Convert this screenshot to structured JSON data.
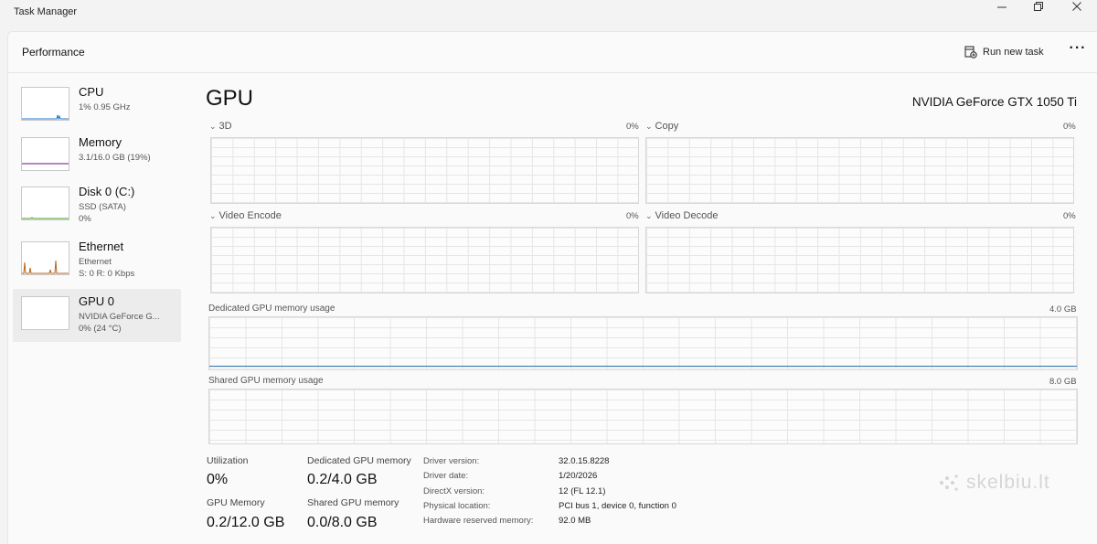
{
  "window": {
    "title": "Task Manager",
    "controls": [
      "minimize-icon",
      "restore-icon",
      "close-icon"
    ]
  },
  "header": {
    "title": "Performance",
    "run_task_label": "Run new task",
    "more_label": "···"
  },
  "sidebar": {
    "items": [
      {
        "label": "CPU",
        "sub1": "1% 0.95 GHz",
        "sub2": ""
      },
      {
        "label": "Memory",
        "sub1": "3.1/16.0 GB (19%)",
        "sub2": ""
      },
      {
        "label": "Disk 0 (C:)",
        "sub1": "SSD (SATA)",
        "sub2": "0%"
      },
      {
        "label": "Ethernet",
        "sub1": "Ethernet",
        "sub2": "S: 0 R: 0 Kbps"
      },
      {
        "label": "GPU 0",
        "sub1": "NVIDIA GeForce G...",
        "sub2": "0% (24 °C)"
      }
    ],
    "selected": "GPU 0"
  },
  "main": {
    "title": "GPU",
    "gpu_name": "NVIDIA GeForce GTX 1050 Ti",
    "engines": [
      {
        "label": "3D",
        "value": "0%"
      },
      {
        "label": "Copy",
        "value": "0%"
      },
      {
        "label": "Video Encode",
        "value": "0%"
      },
      {
        "label": "Video Decode",
        "value": "0%"
      }
    ],
    "dedicated_memory": {
      "label": "Dedicated GPU memory usage",
      "max": "4.0 GB",
      "fraction": 0.05
    },
    "shared_memory": {
      "label": "Shared GPU memory usage",
      "max": "8.0 GB",
      "fraction": 0.0
    }
  },
  "stats": {
    "utilization": {
      "label": "Utilization",
      "value": "0%"
    },
    "dedicated": {
      "label": "Dedicated GPU memory",
      "value": "0.2/4.0 GB"
    },
    "gpu_memory": {
      "label": "GPU Memory",
      "value": "0.2/12.0 GB"
    },
    "shared": {
      "label": "Shared GPU memory",
      "value": "0.0/8.0 GB"
    },
    "info": [
      {
        "key": "Driver version:",
        "value": "32.0.15.8228"
      },
      {
        "key": "Driver date:",
        "value": "1/20/2026"
      },
      {
        "key": "DirectX version:",
        "value": "12 (FL 12.1)"
      },
      {
        "key": "Physical location:",
        "value": "PCI bus 1, device 0, function 0"
      },
      {
        "key": "Hardware reserved memory:",
        "value": "92.0 MB"
      }
    ]
  },
  "watermark": {
    "text": "skelbiu.lt"
  },
  "colors": {
    "memory_line": "#2a6fa8",
    "cpu_line": "#1f78c8",
    "memory_thumb": "#8b3fa0",
    "ethernet_spike": "#b5651d"
  }
}
